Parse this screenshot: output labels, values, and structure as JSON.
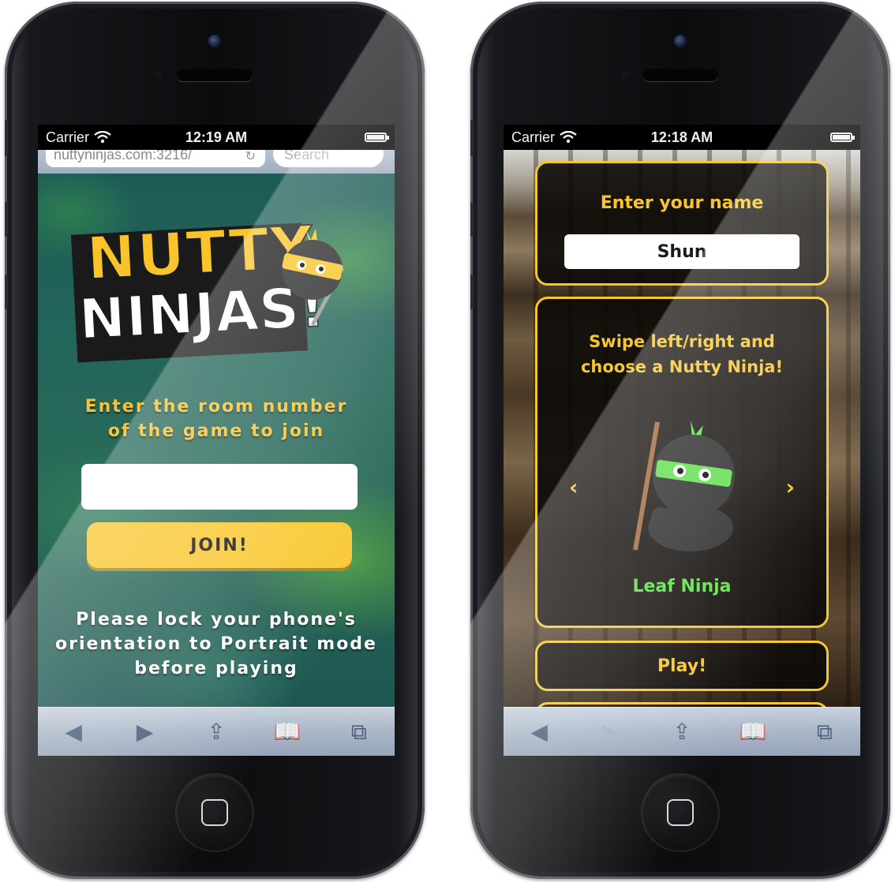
{
  "colors": {
    "accent_yellow": "#f6c62f",
    "leaf_green": "#5ee04a",
    "toolbar_icon": "#4b5f7c"
  },
  "left_phone": {
    "status": {
      "carrier": "Carrier",
      "time": "12:19 AM"
    },
    "browser": {
      "url": "nuttyninjas.com:3216/",
      "search_placeholder": "Search"
    },
    "logo": {
      "line1": "NUTTY",
      "line2": "NINJAS!"
    },
    "prompt": {
      "line1": "Enter the room number",
      "line2": "of the game to join"
    },
    "room_input": {
      "value": "",
      "placeholder": ""
    },
    "join_label": "JOIN!",
    "lock_message": {
      "line1": "Please lock your phone's",
      "line2": "orientation to Portrait mode",
      "line3": "before playing"
    },
    "toolbar": {
      "back_icon": "◀",
      "forward_icon": "▶",
      "share_icon": "⇪",
      "bookmarks_icon": "📖",
      "tabs_icon": "⧉"
    }
  },
  "right_phone": {
    "status": {
      "carrier": "Carrier",
      "time": "12:18 AM"
    },
    "name_panel": {
      "title": "Enter your name",
      "name_value": "Shun"
    },
    "choose_panel": {
      "line1": "Swipe left/right and",
      "line2": "choose a Nutty Ninja!",
      "prev_icon": "‹",
      "next_icon": "›",
      "ninja_name": "Leaf Ninja"
    },
    "play_label": "Play!",
    "toolbar": {
      "back_icon": "◀",
      "forward_icon": "▶",
      "share_icon": "⇪",
      "bookmarks_icon": "📖",
      "tabs_icon": "⧉"
    }
  }
}
